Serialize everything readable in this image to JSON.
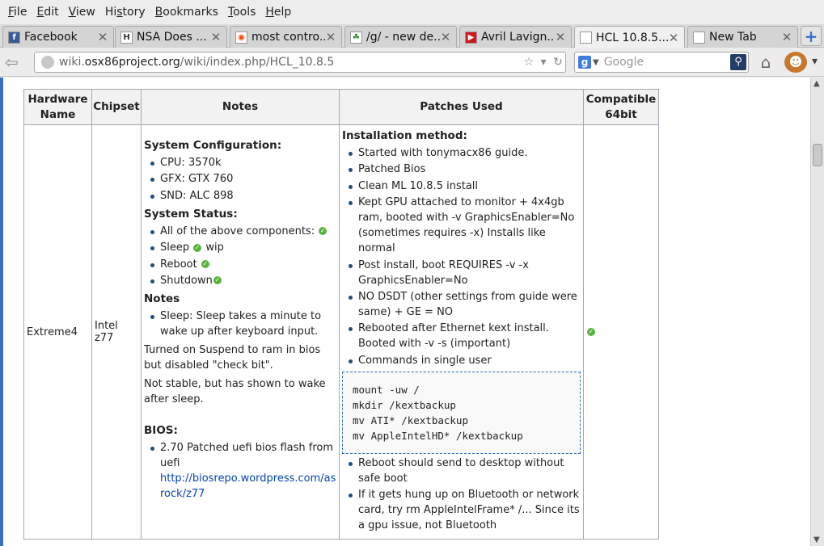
{
  "menu": [
    "File",
    "Edit",
    "View",
    "History",
    "Bookmarks",
    "Tools",
    "Help"
  ],
  "menu_mnemonics": [
    "F",
    "E",
    "V",
    "s",
    "B",
    "T",
    "H"
  ],
  "tabs": [
    {
      "title": "Facebook",
      "icon": "facebook-icon"
    },
    {
      "title": "NSA Does ...",
      "icon": "wiki-icon"
    },
    {
      "title": "most contro...",
      "icon": "reddit-icon"
    },
    {
      "title": "/g/ - new de...",
      "icon": "4chan-icon"
    },
    {
      "title": "Avril Lavign...",
      "icon": "youtube-icon"
    },
    {
      "title": "HCL 10.8.5...",
      "icon": "page-icon"
    },
    {
      "title": "New Tab",
      "icon": "page-icon"
    }
  ],
  "url": {
    "prefix": "wiki.",
    "domain": "osx86project.org",
    "path": "/wiki/index.php/HCL_10.8.5"
  },
  "search": {
    "placeholder": "Google"
  },
  "table": {
    "headers": [
      "Hardware Name",
      "Chipset",
      "Notes",
      "Patches Used",
      "Compatible 64bit"
    ],
    "row": {
      "hardware": "Extreme4",
      "chipset": "Intel z77",
      "notes": {
        "sysconfig_heading": "System Configuration:",
        "sysconfig": [
          "CPU: 3570k",
          "GFX: GTX 760",
          "SND: ALC 898"
        ],
        "status_heading": "System Status:",
        "status": [
          {
            "text": "All of the above components:",
            "suffix": ""
          },
          {
            "text": "Sleep",
            "suffix": "wip"
          },
          {
            "text": "Reboot",
            "suffix": ""
          },
          {
            "text": "Shutdown",
            "suffix": ""
          }
        ],
        "notes_heading": "Notes",
        "notes_items": [
          "Sleep: Sleep takes a minute to wake up after keyboard input."
        ],
        "para1": "Turned on Suspend to ram in bios but disabled \"check bit\".",
        "para2": "Not stable, but has shown to wake after sleep.",
        "bios_heading": "BIOS:",
        "bios_text": "2.70 Patched uefi bios flash from uefi",
        "bios_link": "http://biosrepo.wordpress.com/asrock/z77"
      },
      "patches": {
        "heading": "Installation method:",
        "items": [
          "Started with tonymacx86 guide.",
          "Patched Bios",
          "Clean ML 10.8.5 install",
          "Kept GPU attached to monitor + 4x4gb ram, booted with -v GraphicsEnabler=No (sometimes requires -x) Installs like normal",
          "Post install, boot REQUIRES -v -x GraphicsEnabler=No",
          "NO DSDT (other settings from guide were same) + GE = NO",
          "Rebooted after Ethernet kext install. Booted with -v -s (important)",
          "Commands in single user"
        ],
        "code": "mount -uw /\nmkdir /kextbackup\nmv ATI* /kextbackup\nmv AppleIntelHD* /kextbackup",
        "items_after": [
          "Reboot should send to desktop without safe boot",
          "If it gets hung up on Bluetooth or network card, try rm AppleIntelFrame* /... Since its a gpu issue, not Bluetooth"
        ]
      },
      "compatible": ""
    }
  },
  "colors": {
    "accent": "#3a6ec5",
    "link": "#0645ad",
    "check": "#5bb33b"
  }
}
